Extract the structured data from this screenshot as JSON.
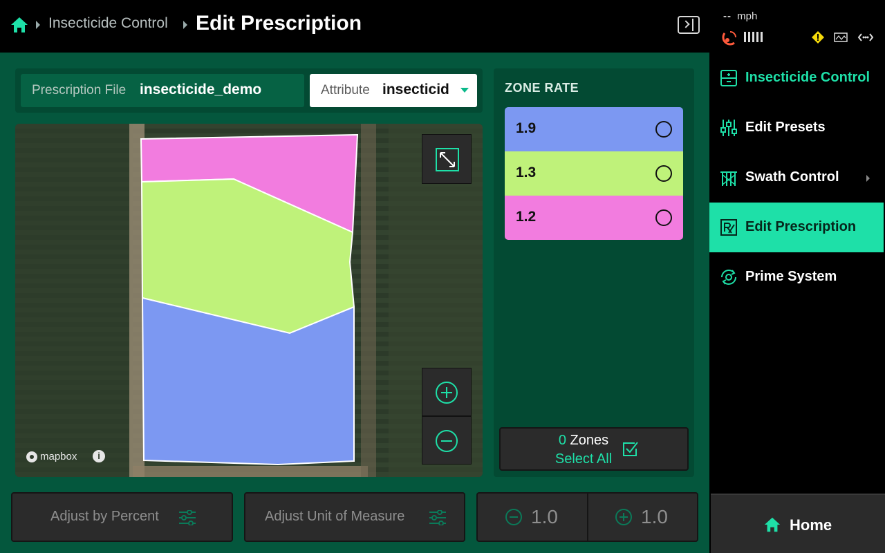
{
  "header": {
    "breadcrumb_parent": "Insecticide Control",
    "page_title": "Edit Prescription"
  },
  "prescription": {
    "file_label": "Prescription File",
    "file_value": "insecticide_demo",
    "attribute_label": "Attribute",
    "attribute_value": "insecticid"
  },
  "map": {
    "attribution": "mapbox",
    "info_label": "i",
    "zone_colors": {
      "blue": "#7c98f2",
      "green": "#bff27a",
      "pink": "#f27cdf"
    }
  },
  "zone_panel": {
    "title": "ZONE RATE",
    "zones": [
      {
        "rate": "1.9",
        "color": "#7c98f2"
      },
      {
        "rate": "1.3",
        "color": "#bff27a"
      },
      {
        "rate": "1.2",
        "color": "#f27cdf"
      }
    ],
    "selected_count": "0",
    "zones_label": "Zones",
    "select_all_label": "Select All"
  },
  "bottom_bar": {
    "adjust_percent_label": "Adjust by Percent",
    "adjust_uom_label": "Adjust Unit of Measure",
    "decrement_value": "1.0",
    "increment_value": "1.0"
  },
  "status": {
    "speed_value": "--",
    "speed_unit": "mph"
  },
  "sidebar": {
    "items": [
      {
        "label": "Insecticide Control",
        "icon": "insecticide-control-icon"
      },
      {
        "label": "Edit Presets",
        "icon": "sliders-icon"
      },
      {
        "label": "Swath Control",
        "icon": "swath-icon"
      },
      {
        "label": "Edit Prescription",
        "icon": "prescription-icon"
      },
      {
        "label": "Prime System",
        "icon": "prime-icon"
      }
    ],
    "home_label": "Home"
  },
  "colors": {
    "accent": "#1ee0a8",
    "main_bg": "#04573d",
    "panel_bg": "#034a33",
    "warning": "#f5d90a"
  }
}
